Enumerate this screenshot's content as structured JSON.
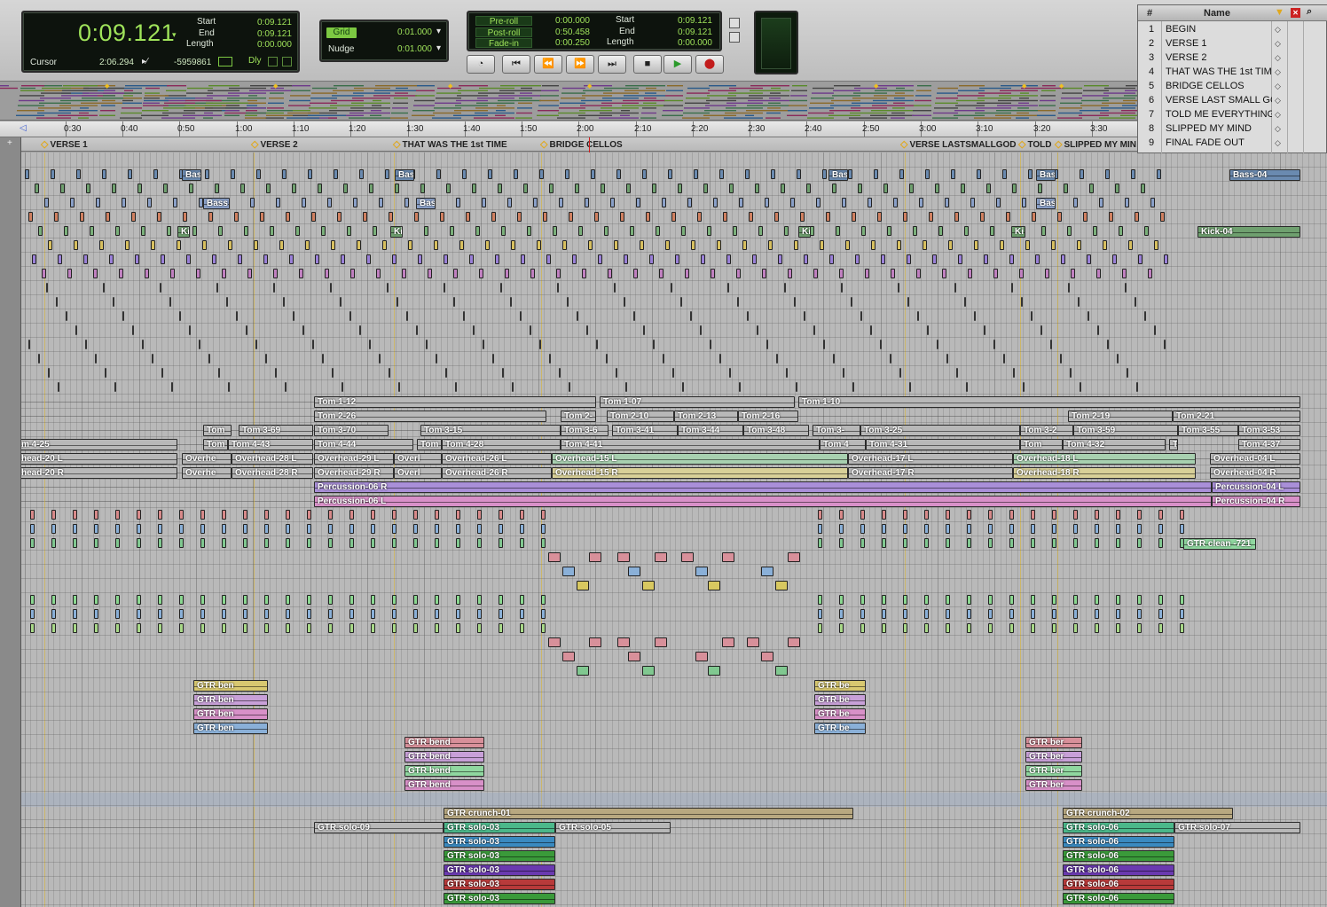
{
  "counter": {
    "main_time": "0:09.121",
    "start_label": "Start",
    "start_val": "0:09.121",
    "end_label": "End",
    "end_val": "0:09.121",
    "length_label": "Length",
    "length_val": "0:00.000",
    "cursor_label": "Cursor",
    "cursor_val": "2:06.294",
    "cursor_sample": "-5959861",
    "dly_label": "Dly"
  },
  "grid": {
    "grid_label": "Grid",
    "grid_val": "0:01.000",
    "nudge_label": "Nudge",
    "nudge_val": "0:01.000"
  },
  "prepost": {
    "preroll_label": "Pre-roll",
    "preroll_val": "0:00.000",
    "postroll_label": "Post-roll",
    "postroll_val": "0:50.458",
    "fadein_label": "Fade-in",
    "fadein_val": "0:00.250",
    "start_label": "Start",
    "start_val": "0:09.121",
    "end_label": "End",
    "end_val": "0:09.121",
    "length_label": "Length",
    "length_val": "0:00.000"
  },
  "transport_icons": [
    "online-icon",
    "return-to-zero-icon",
    "rewind-icon",
    "fast-forward-icon",
    "go-to-end-icon",
    "stop-icon",
    "play-icon",
    "record-icon"
  ],
  "memory_locations": {
    "header_num": "#",
    "header_name": "Name",
    "rows": [
      {
        "num": "1",
        "name": "BEGIN"
      },
      {
        "num": "2",
        "name": "VERSE 1"
      },
      {
        "num": "3",
        "name": "VERSE 2"
      },
      {
        "num": "4",
        "name": "THAT WAS THE 1st TIMI"
      },
      {
        "num": "5",
        "name": "BRIDGE CELLOS"
      },
      {
        "num": "6",
        "name": "VERSE LAST SMALL GC"
      },
      {
        "num": "7",
        "name": "TOLD ME EVERYTHING"
      },
      {
        "num": "8",
        "name": "SLIPPED MY MIND"
      },
      {
        "num": "9",
        "name": "FINAL FADE OUT"
      }
    ]
  },
  "ruler": {
    "ticks": [
      {
        "label": "0:30"
      },
      {
        "label": "0:40"
      },
      {
        "label": "0:50"
      },
      {
        "label": "1:00"
      },
      {
        "label": "1:10"
      },
      {
        "label": "1:20"
      },
      {
        "label": "1:30"
      },
      {
        "label": "1:40"
      },
      {
        "label": "1:50"
      },
      {
        "label": "2:00"
      },
      {
        "label": "2:10"
      },
      {
        "label": "2:20"
      },
      {
        "label": "2:30"
      },
      {
        "label": "2:40"
      },
      {
        "label": "2:50"
      },
      {
        "label": "3:00"
      },
      {
        "label": "3:10"
      },
      {
        "label": "3:20"
      },
      {
        "label": "3:30"
      }
    ]
  },
  "markers": [
    {
      "label": "VERSE 1"
    },
    {
      "label": "VERSE 2"
    },
    {
      "label": "THAT WAS THE 1st TIME"
    },
    {
      "label": "BRIDGE CELLOS"
    },
    {
      "label": "VERSE LASTSMALLGOD"
    },
    {
      "label": "TOLD"
    },
    {
      "label": "SLIPPED MY MIN"
    }
  ],
  "clips": [
    {
      "label": "Bas"
    },
    {
      "label": "Bas"
    },
    {
      "label": "Bas"
    },
    {
      "label": "Bas"
    },
    {
      "label": "Bass-04"
    },
    {
      "label": "Bass"
    },
    {
      "label": "Bas"
    },
    {
      "label": "Bas"
    },
    {
      "label": "Ki"
    },
    {
      "label": "Ki"
    },
    {
      "label": "Ki"
    },
    {
      "label": "Ki"
    },
    {
      "label": "Kick-04"
    },
    {
      "label": "Tom 1-12"
    },
    {
      "label": "Tom 1-07"
    },
    {
      "label": "Tom 1-10"
    },
    {
      "label": "Tom 2-26"
    },
    {
      "label": "Tom 2-"
    },
    {
      "label": "Tom 2-10"
    },
    {
      "label": "Tom 2-13"
    },
    {
      "label": "Tom 2-16"
    },
    {
      "label": "Tom 2-19"
    },
    {
      "label": "Tom 2-21"
    },
    {
      "label": "Tom"
    },
    {
      "label": "Tom 3-69"
    },
    {
      "label": "Tom 3-70"
    },
    {
      "label": "Tom 3-15"
    },
    {
      "label": "Tom 3-6"
    },
    {
      "label": "Tom 3-41"
    },
    {
      "label": "Tom 3-44"
    },
    {
      "label": "Tom 3-48"
    },
    {
      "label": "Tom 3-"
    },
    {
      "label": "Tom 3-25"
    },
    {
      "label": "Tom 3-2"
    },
    {
      "label": "Tom 3-59"
    },
    {
      "label": "Tom 3-55"
    },
    {
      "label": "Tom 3-53"
    },
    {
      "label": "m 4-25"
    },
    {
      "label": "Tom"
    },
    {
      "label": "Tom 4-43"
    },
    {
      "label": "Tom 4-44"
    },
    {
      "label": "Tom"
    },
    {
      "label": "Tom 4-28"
    },
    {
      "label": "Tom 4-41"
    },
    {
      "label": "Tom 4"
    },
    {
      "label": "Tom 4-31"
    },
    {
      "label": "Tom"
    },
    {
      "label": "Tom 4-32"
    },
    {
      "label": "T"
    },
    {
      "label": "Tom 4-37"
    },
    {
      "label": "head-20 L"
    },
    {
      "label": "Overhe"
    },
    {
      "label": "Overhead-28 L"
    },
    {
      "label": "Overhead-29 L"
    },
    {
      "label": "Overl"
    },
    {
      "label": "Overhead-26 L"
    },
    {
      "label": "Overhead-15 L"
    },
    {
      "label": "Overhead-17 L"
    },
    {
      "label": "Overhead-18 L"
    },
    {
      "label": "Overhead-04 L"
    },
    {
      "label": "head-20 R"
    },
    {
      "label": "Overhe"
    },
    {
      "label": "Overhead-28 R"
    },
    {
      "label": "Overhead-29 R"
    },
    {
      "label": "Overl"
    },
    {
      "label": "Overhead-26 R"
    },
    {
      "label": "Overhead-15 R"
    },
    {
      "label": "Overhead-17 R"
    },
    {
      "label": "Overhead-18 R"
    },
    {
      "label": "Overhead-04 R"
    },
    {
      "label": "Percussion-06 R"
    },
    {
      "label": "Percussion-04 L"
    },
    {
      "label": "Percussion-06 L"
    },
    {
      "label": "Percussion-04 R"
    },
    {
      "label": "GTR clean -721"
    },
    {
      "label": "GTR ben"
    },
    {
      "label": "GTR ben"
    },
    {
      "label": "GTR ben"
    },
    {
      "label": "GTR ben"
    },
    {
      "label": "GTR be"
    },
    {
      "label": "GTR be"
    },
    {
      "label": "GTR be"
    },
    {
      "label": "GTR be"
    },
    {
      "label": "GTR bend"
    },
    {
      "label": "GTR bend"
    },
    {
      "label": "GTR bend"
    },
    {
      "label": "GTR bend"
    },
    {
      "label": "GTR ber"
    },
    {
      "label": "GTR ber"
    },
    {
      "label": "GTR ber"
    },
    {
      "label": "GTR ber"
    },
    {
      "label": "GTR crunch-01"
    },
    {
      "label": "GTR crunch-02"
    },
    {
      "label": "GTR solo-09"
    },
    {
      "label": "GTR solo-03"
    },
    {
      "label": "GTR solo-05"
    },
    {
      "label": "GTR solo-06"
    },
    {
      "label": "GTR solo-07"
    },
    {
      "label": "GTR solo-03"
    },
    {
      "label": "GTR solo-06"
    },
    {
      "label": "GTR solo-03"
    },
    {
      "label": "GTR solo-06"
    },
    {
      "label": "GTR solo-03"
    },
    {
      "label": "GTR solo-06"
    },
    {
      "label": "GTR solo-03"
    },
    {
      "label": "GTR solo-06"
    },
    {
      "label": "GTR solo-03"
    },
    {
      "label": "GTR solo-06"
    }
  ],
  "colors": {
    "lcd_green": "#9fe35a",
    "playhead": "#d41c1c",
    "marker_diamond": "#e0a81c",
    "track_bg": "#b9b9b9"
  }
}
